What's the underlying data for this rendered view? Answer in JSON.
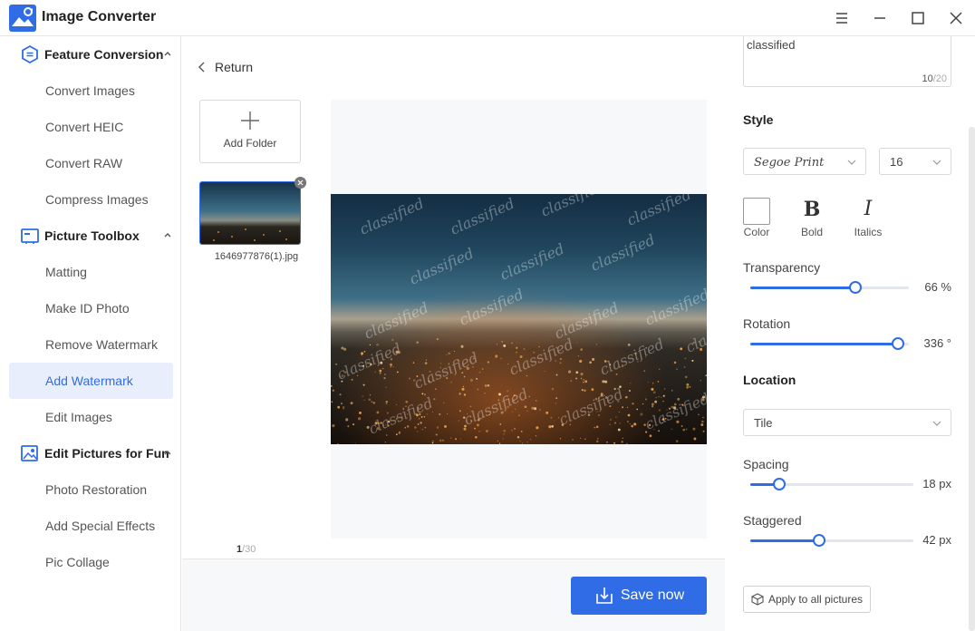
{
  "app": {
    "title": "Image Converter"
  },
  "sidebar": {
    "sections": [
      {
        "label": "Feature Conversion",
        "icon": "feature-conversion-icon"
      },
      {
        "label": "Picture Toolbox",
        "icon": "picture-toolbox-icon"
      },
      {
        "label": "Edit Pictures for Fun",
        "icon": "edit-pictures-icon"
      }
    ],
    "items": [
      "Convert Images",
      "Convert HEIC",
      "Convert RAW",
      "Compress Images",
      "Matting",
      "Make ID Photo",
      "Remove Watermark",
      "Add Watermark",
      "Edit Images",
      "Photo Restoration",
      "Add Special Effects",
      "Pic Collage"
    ],
    "active_item": "Add Watermark"
  },
  "center": {
    "return_label": "Return",
    "add_folder_label": "Add Folder",
    "file_name": "1646977876(1).jpg",
    "counter_current": "1",
    "counter_total": "/30",
    "save_label": "Save now",
    "watermark_text": "classified"
  },
  "panel": {
    "text_value": "classified",
    "char_count": "10",
    "char_max": "/20",
    "style_title": "Style",
    "font_value": "Segoe Print",
    "size_value": "16",
    "color_label": "Color",
    "bold_label": "Bold",
    "bold_glyph": "B",
    "italics_label": "Italics",
    "italics_glyph": "I",
    "transparency_label": "Transparency",
    "transparency_value": "66 %",
    "transparency_fraction": 0.66,
    "rotation_label": "Rotation",
    "rotation_value": "336 °",
    "rotation_fraction": 0.933,
    "location_title": "Location",
    "location_value": "Tile",
    "spacing_label": "Spacing",
    "spacing_value": "18 px",
    "spacing_fraction": 0.18,
    "staggered_label": "Staggered",
    "staggered_value": "42 px",
    "staggered_fraction": 0.42,
    "apply_label": "Apply to all pictures"
  },
  "colors": {
    "accent": "#2f6ce5",
    "active_bg": "#e8eefb"
  }
}
